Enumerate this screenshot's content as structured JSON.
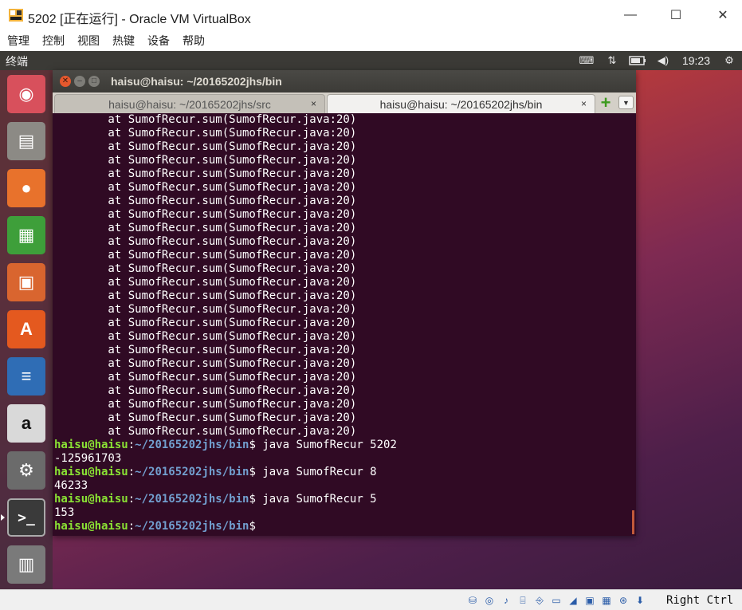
{
  "host": {
    "title": "5202 [正在运行] - Oracle VM VirtualBox",
    "menu": [
      "管理",
      "控制",
      "视图",
      "热键",
      "设备",
      "帮助"
    ],
    "window_controls": [
      "minimize-icon",
      "maximize-icon",
      "close-icon"
    ],
    "status_icons": [
      "hard-disk-icon",
      "optical-drive-icon",
      "audio-icon",
      "network-icon",
      "usb-icon",
      "shared-folders-icon",
      "display-icon",
      "recording-icon",
      "cpu-icon",
      "mouse-integration-icon",
      "download-icon"
    ],
    "host_key": "Right Ctrl"
  },
  "guest": {
    "panel": {
      "title": "终端",
      "tray": [
        "keyboard-icon",
        "network-arrows-icon",
        "battery-icon",
        "volume-icon"
      ],
      "clock": "19:23",
      "power_icon": "gear-power-icon"
    },
    "launcher": [
      {
        "name": "ubuntu-dash-icon",
        "glyph": "◉",
        "bg": "#d8505c"
      },
      {
        "name": "files-icon",
        "glyph": "▤",
        "bg": "#8c8a85"
      },
      {
        "name": "firefox-icon",
        "glyph": "●",
        "bg": "#e8722c"
      },
      {
        "name": "libreoffice-calc-icon",
        "glyph": "▦",
        "bg": "#3e9f3a"
      },
      {
        "name": "libreoffice-impress-icon",
        "glyph": "▣",
        "bg": "#d9652f"
      },
      {
        "name": "software-center-icon",
        "glyph": "A",
        "bg": "#e4591f"
      },
      {
        "name": "libreoffice-writer-icon",
        "glyph": "≡",
        "bg": "#2f6db5"
      },
      {
        "name": "amazon-icon",
        "glyph": "a",
        "bg": "#d9d9d9"
      },
      {
        "name": "system-settings-icon",
        "glyph": "⚙",
        "bg": "#6b6b6b"
      },
      {
        "name": "terminal-icon",
        "glyph": ">_",
        "bg": "#3a3a3a"
      },
      {
        "name": "trash-icon",
        "glyph": "🗑",
        "bg": "#7a7a7a"
      }
    ],
    "terminal": {
      "title": "haisu@haisu: ~/20165202jhs/bin",
      "tabs": [
        {
          "label": "haisu@haisu: ~/20165202jhs/src"
        },
        {
          "label": "haisu@haisu: ~/20165202jhs/bin"
        }
      ],
      "tab_close": "×",
      "stack_trace": [
        "        at SumofRecur.sum(SumofRecur.java:20)",
        "        at SumofRecur.sum(SumofRecur.java:20)",
        "        at SumofRecur.sum(SumofRecur.java:20)",
        "        at SumofRecur.sum(SumofRecur.java:20)",
        "        at SumofRecur.sum(SumofRecur.java:20)",
        "        at SumofRecur.sum(SumofRecur.java:20)",
        "        at SumofRecur.sum(SumofRecur.java:20)",
        "        at SumofRecur.sum(SumofRecur.java:20)",
        "        at SumofRecur.sum(SumofRecur.java:20)",
        "        at SumofRecur.sum(SumofRecur.java:20)",
        "        at SumofRecur.sum(SumofRecur.java:20)",
        "        at SumofRecur.sum(SumofRecur.java:20)",
        "        at SumofRecur.sum(SumofRecur.java:20)",
        "        at SumofRecur.sum(SumofRecur.java:20)",
        "        at SumofRecur.sum(SumofRecur.java:20)",
        "        at SumofRecur.sum(SumofRecur.java:20)",
        "        at SumofRecur.sum(SumofRecur.java:20)",
        "        at SumofRecur.sum(SumofRecur.java:20)",
        "        at SumofRecur.sum(SumofRecur.java:20)",
        "        at SumofRecur.sum(SumofRecur.java:20)",
        "        at SumofRecur.sum(SumofRecur.java:20)",
        "        at SumofRecur.sum(SumofRecur.java:20)",
        "        at SumofRecur.sum(SumofRecur.java:20)",
        "        at SumofRecur.sum(SumofRecur.java:20)"
      ],
      "prompt_user": "haisu@haisu",
      "prompt_sep": ":",
      "prompt_path": "~/20165202jhs/bin",
      "prompt_end": "$ ",
      "sessions": [
        {
          "command": "java SumofRecur 5202",
          "output": "-125961703"
        },
        {
          "command": "java SumofRecur 8",
          "output": "46233"
        },
        {
          "command": "java SumofRecur 5",
          "output": "153"
        }
      ],
      "final_prompt_end": "$"
    }
  }
}
